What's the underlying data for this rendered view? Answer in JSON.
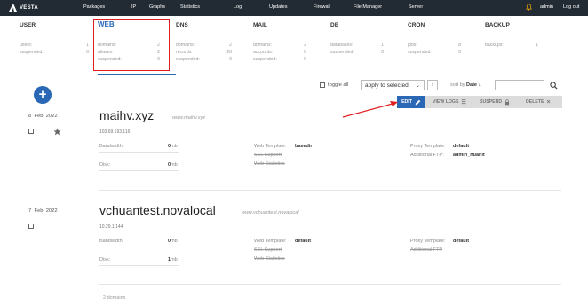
{
  "nav": {
    "brand": "VESTA",
    "items": [
      "Packages",
      "IP",
      "Graphs",
      "Statistics",
      "Log",
      "Updates",
      "Firewall",
      "File Manager",
      "Server"
    ],
    "user": "admin",
    "logout": "Log out"
  },
  "stats": [
    {
      "title": "USER",
      "rows": [
        [
          "users:",
          "1"
        ],
        [
          "suspended:",
          "0"
        ]
      ]
    },
    {
      "title": "WEB",
      "rows": [
        [
          "domains:",
          "2"
        ],
        [
          "aliases:",
          "2"
        ],
        [
          "suspended:",
          "0"
        ]
      ]
    },
    {
      "title": "DNS",
      "rows": [
        [
          "domains:",
          "2"
        ],
        [
          "records:",
          "28"
        ],
        [
          "suspended:",
          "0"
        ]
      ]
    },
    {
      "title": "MAIL",
      "rows": [
        [
          "domains:",
          "2"
        ],
        [
          "accounts:",
          "0"
        ],
        [
          "suspended:",
          "0"
        ]
      ]
    },
    {
      "title": "DB",
      "rows": [
        [
          "databases:",
          "1"
        ],
        [
          "suspended:",
          "0"
        ]
      ]
    },
    {
      "title": "CRON",
      "rows": [
        [
          "jobs:",
          "8"
        ],
        [
          "suspended:",
          "0"
        ]
      ]
    },
    {
      "title": "BACKUP",
      "rows": [
        [
          "backups:",
          "1"
        ]
      ]
    }
  ],
  "toolbar": {
    "toggle_all": "toggle all",
    "apply_selected": "apply to selected",
    "sort_by": "sort by",
    "sort_value": "Date ↓"
  },
  "actions": {
    "edit": "EDIT",
    "view_logs": "VIEW LOGS",
    "suspend": "SUSPEND",
    "delete": "DELETE"
  },
  "domains": [
    {
      "day": "8",
      "month": "Feb",
      "year": "2022",
      "name": "maihv.xyz",
      "alias": "www.maihv.xyz",
      "ip": "103.69.193.116",
      "bandwidth_label": "Bandwidth",
      "bandwidth": "0",
      "disk_label": "Disk:",
      "disk": "0",
      "unit": "mb",
      "web_template_label": "Web Template:",
      "web_template": "basedir",
      "ssl": "SSL Support",
      "web_stats": "Web Statistics",
      "proxy_template_label": "Proxy Template:",
      "proxy_template": "default",
      "ftp_label": "Additional FTP:",
      "ftp": "admin_huanit"
    },
    {
      "day": "7",
      "month": "Feb",
      "year": "2022",
      "name": "vchuantest.novalocal",
      "alias": "www.vchuantest.novalocal",
      "ip": "10.29.1.144",
      "bandwidth_label": "Bandwidth",
      "bandwidth": "0",
      "disk_label": "Disk:",
      "disk": "1",
      "unit": "mb",
      "web_template_label": "Web Template:",
      "web_template": "default",
      "ssl": "SSL Support",
      "web_stats": "Web Statistics",
      "proxy_template_label": "Proxy Template:",
      "proxy_template": "default",
      "ftp_label": "Additional FTP",
      "ftp": ""
    }
  ],
  "footer": {
    "count": "2 domains"
  },
  "colors": {
    "nav_bg": "#222a33",
    "accent": "#2a68b6",
    "highlight": "#e02020",
    "bell": "#f0a500"
  }
}
